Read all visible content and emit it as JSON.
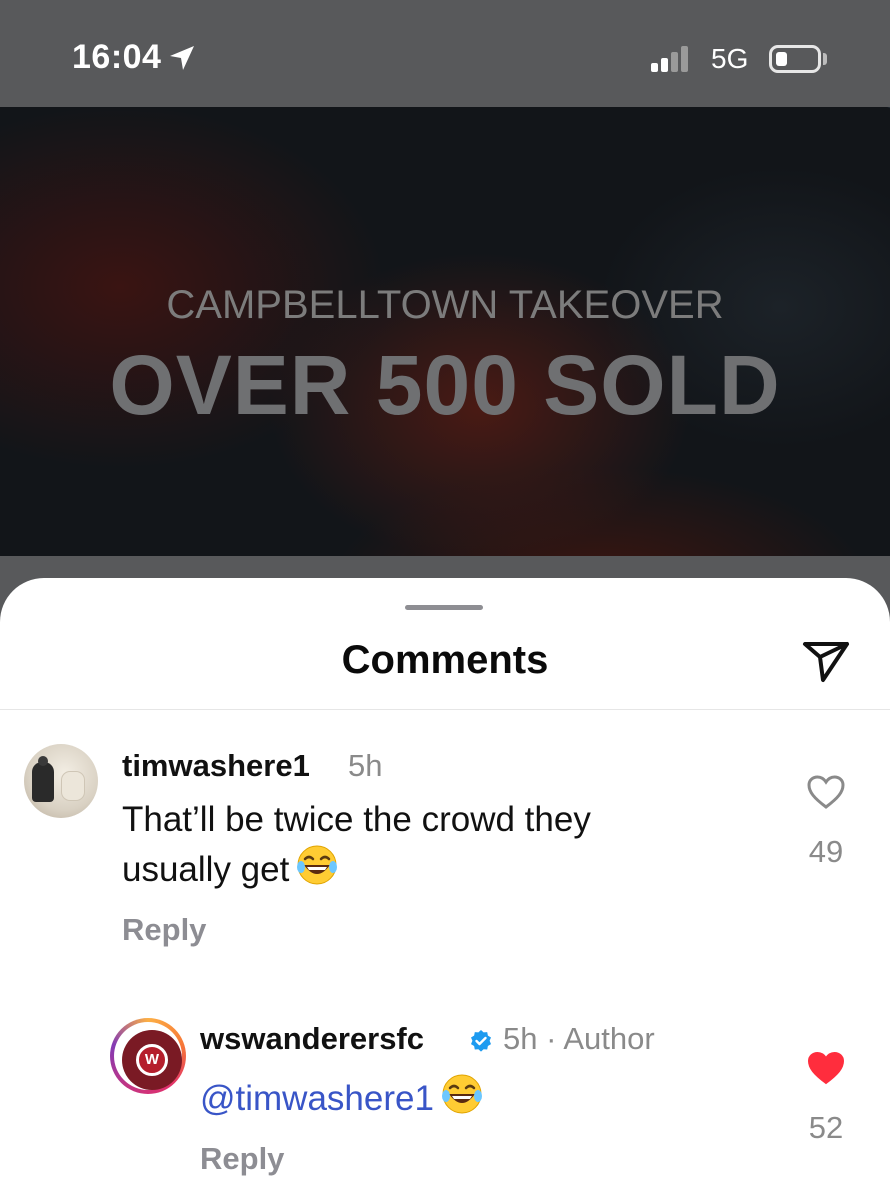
{
  "status_bar": {
    "time": "16:04",
    "network": "5G"
  },
  "post": {
    "subtitle": "CAMPBELLTOWN TAKEOVER",
    "title": "OVER 500 SOLD"
  },
  "sheet": {
    "title": "Comments"
  },
  "comments": [
    {
      "username": "timwashere1",
      "time": "5h",
      "text_line1": "That’ll be twice the crowd they",
      "text_line2": "usually get",
      "reply_label": "Reply",
      "likes": "49",
      "liked": false
    },
    {
      "username": "wswanderersfc",
      "time": "5h · Author",
      "mention": "@timwashere1",
      "reply_label": "Reply",
      "likes": "52",
      "liked": true,
      "verified": true
    }
  ],
  "colors": {
    "like_active": "#ff2d3d",
    "mention": "#3955c7",
    "verified": "#1d9bf0"
  },
  "icons": [
    "location-arrow-icon",
    "signal-icon",
    "battery-icon",
    "share-icon",
    "heart-icon",
    "verified-icon",
    "laughing-emoji"
  ]
}
